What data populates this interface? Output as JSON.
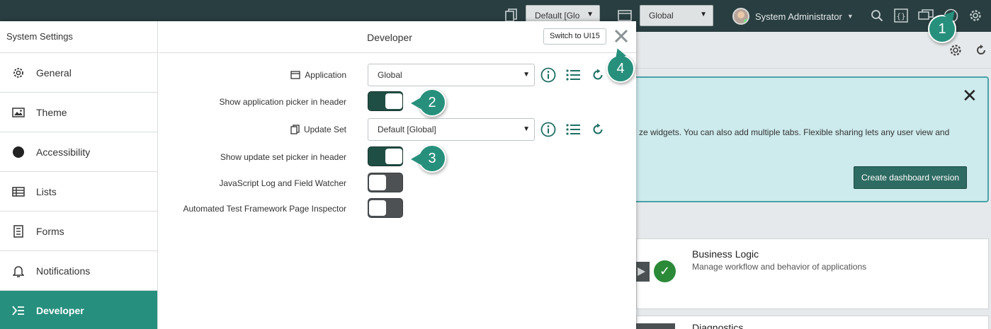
{
  "header": {
    "update_set_select": "Default [Glo",
    "application_select": "Global",
    "user_name": "System Administrator"
  },
  "background": {
    "banner_text": "ze widgets. You can also add multiple tabs. Flexible sharing lets any user view and",
    "create_dashboard_button": "Create dashboard version",
    "cards": [
      {
        "title": "Business Logic",
        "description": "Manage workflow and behavior of applications"
      },
      {
        "title": "Diagnostics",
        "description": ""
      }
    ]
  },
  "settings": {
    "title": "System Settings",
    "items": [
      {
        "label": "General",
        "icon": "gear-icon"
      },
      {
        "label": "Theme",
        "icon": "image-icon"
      },
      {
        "label": "Accessibility",
        "icon": "circle-icon"
      },
      {
        "label": "Lists",
        "icon": "list-table-icon"
      },
      {
        "label": "Forms",
        "icon": "form-icon"
      },
      {
        "label": "Notifications",
        "icon": "bell-icon"
      },
      {
        "label": "Developer",
        "icon": "developer-icon"
      }
    ],
    "active_item": "Developer"
  },
  "developer": {
    "title": "Developer",
    "switch_button": "Switch to UI15",
    "application_label": "Application",
    "application_value": "Global",
    "show_app_picker_label": "Show application picker in header",
    "show_app_picker_on": true,
    "update_set_label": "Update Set",
    "update_set_value": "Default [Global]",
    "show_update_set_picker_label": "Show update set picker in header",
    "show_update_set_picker_on": true,
    "js_log_label": "JavaScript Log and Field Watcher",
    "js_log_on": false,
    "atf_label": "Automated Test Framework Page Inspector",
    "atf_on": false
  },
  "callouts": [
    "1",
    "2",
    "3",
    "4"
  ],
  "colors": {
    "header_bg": "#293e40",
    "accent": "#278f7e",
    "toggle_on": "#1f4f44",
    "toggle_off": "#4d5153",
    "icon_teal": "#1f6f64"
  }
}
